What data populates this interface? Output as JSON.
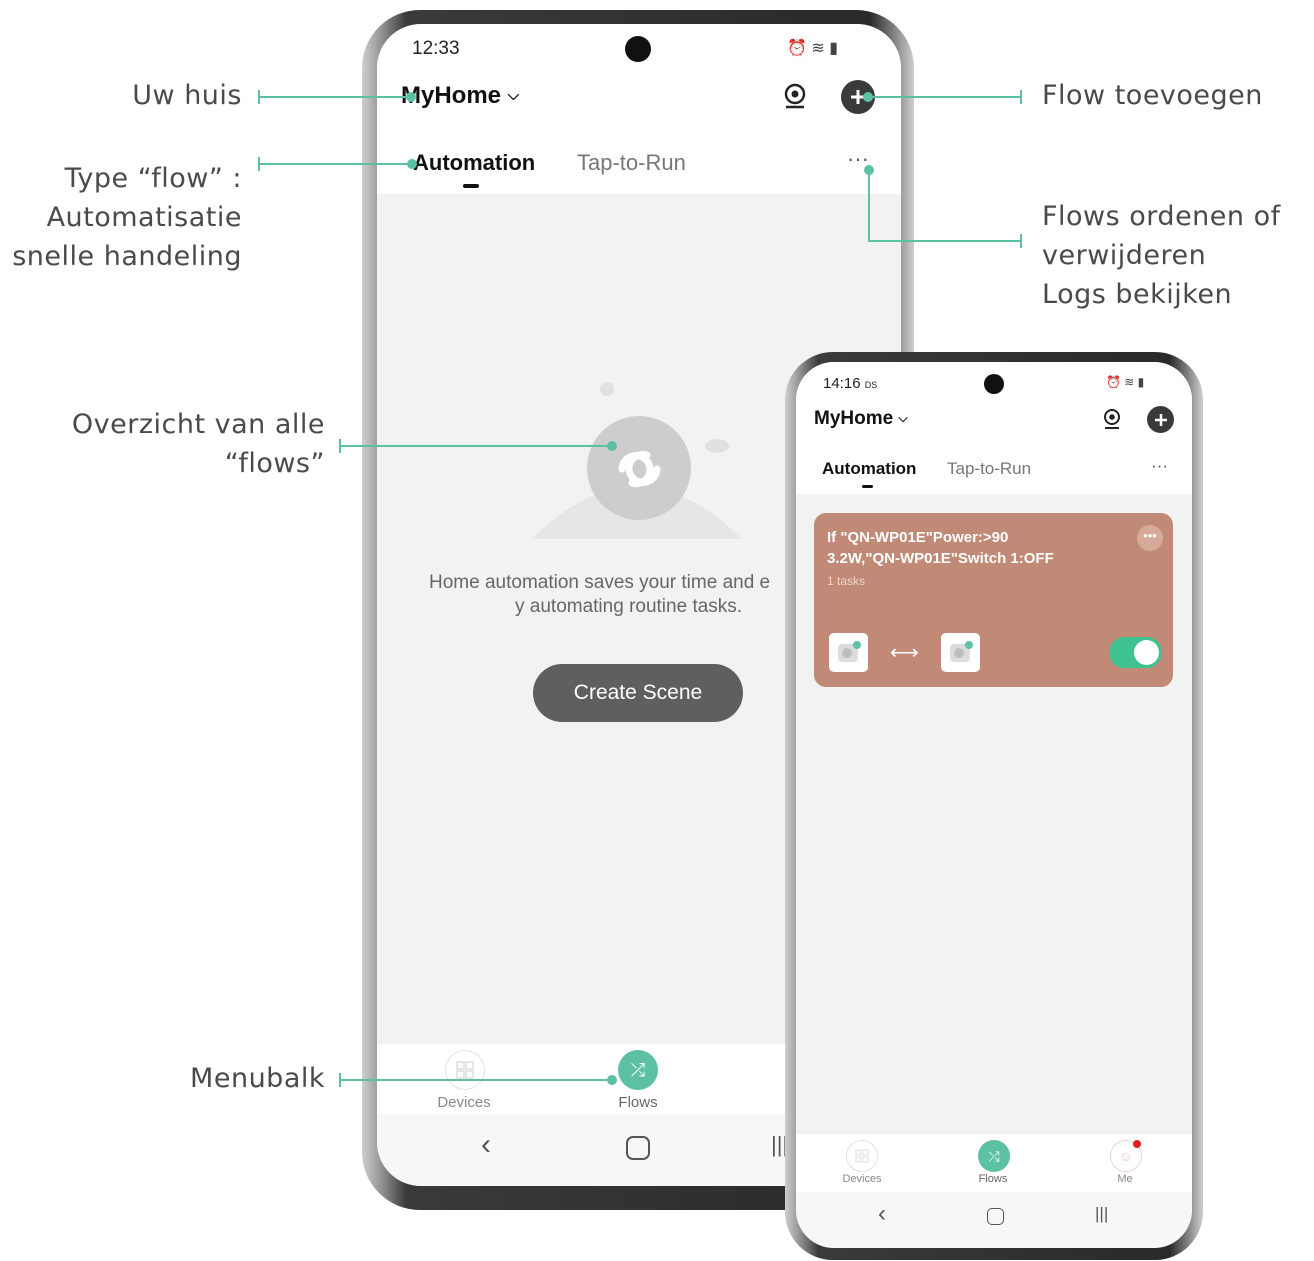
{
  "annotations": {
    "uw_huis": "Uw huis",
    "type_flow": [
      "Type “flow” :",
      "Automatisatie",
      "snelle handeling"
    ],
    "overzicht": [
      "Overzicht van alle",
      "“flows”"
    ],
    "menubalk": "Menubalk",
    "flow_toevoegen": "Flow toevoegen",
    "flows_ordenen": [
      "Flows ordenen of",
      "verwijderen",
      "Logs bekijken"
    ]
  },
  "phone_left": {
    "time": "12:33",
    "home": "MyHome",
    "tabs": [
      "Automation",
      "Tap-to-Run"
    ],
    "empty_text_1": "Home automation saves your time and e",
    "empty_text_2": "y automating routine tasks.",
    "create_button": "Create Scene",
    "nav": [
      "Devices",
      "Flows"
    ]
  },
  "phone_right": {
    "time": "14:16",
    "status_extra": "DS",
    "home": "MyHome",
    "tabs": [
      "Automation",
      "Tap-to-Run"
    ],
    "card": {
      "title_1": "If \"QN-WP01E\"Power:>90",
      "title_2": "3.2W,\"QN-WP01E\"Switch 1:OFF",
      "tasks": "1 tasks",
      "color": "#c08a76",
      "toggle_on": true
    },
    "nav": [
      "Devices",
      "Flows",
      "Me"
    ]
  },
  "colors": {
    "accent": "#5cc0a4",
    "button": "#5f5f5f"
  },
  "icons": [
    "chevron-down-icon",
    "scan-icon",
    "add-icon",
    "more-icon",
    "scene-icon",
    "devices-icon",
    "flows-icon",
    "me-icon",
    "back-icon",
    "home-icon",
    "recents-icon",
    "plug-icon",
    "arrow-icon"
  ]
}
